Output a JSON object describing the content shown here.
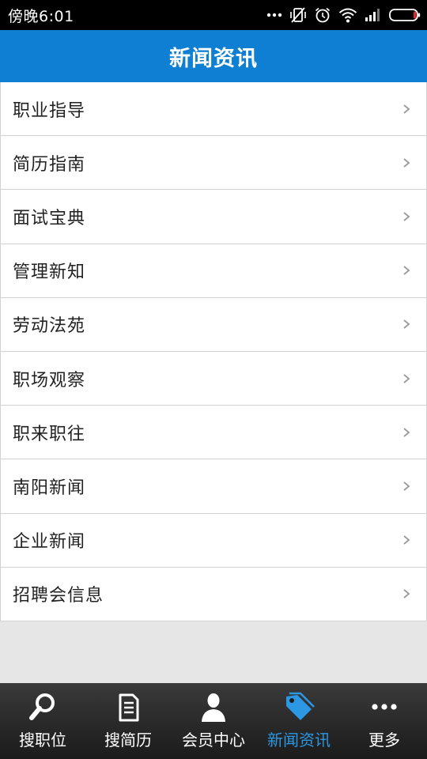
{
  "status_bar": {
    "time": "傍晚6:01",
    "icons": [
      "more-dots-icon",
      "vibrate-off-icon",
      "alarm-icon",
      "wifi-icon",
      "signal-icon",
      "battery-icon"
    ]
  },
  "header": {
    "title": "新闻资讯"
  },
  "menu": {
    "items": [
      {
        "label": "职业指导"
      },
      {
        "label": "简历指南"
      },
      {
        "label": "面试宝典"
      },
      {
        "label": "管理新知"
      },
      {
        "label": "劳动法苑"
      },
      {
        "label": "职场观察"
      },
      {
        "label": "职来职往"
      },
      {
        "label": "南阳新闻"
      },
      {
        "label": "企业新闻"
      },
      {
        "label": "招聘会信息"
      }
    ]
  },
  "tabbar": {
    "tabs": [
      {
        "label": "搜职位",
        "icon": "search-icon",
        "active": false
      },
      {
        "label": "搜简历",
        "icon": "document-icon",
        "active": false
      },
      {
        "label": "会员中心",
        "icon": "user-icon",
        "active": false
      },
      {
        "label": "新闻资讯",
        "icon": "tag-icon",
        "active": true
      },
      {
        "label": "更多",
        "icon": "more-icon",
        "active": false
      }
    ]
  },
  "colors": {
    "header_blue": "#0f7fd3",
    "active_tab": "#2c97e3",
    "battery_red": "#e8262a"
  }
}
